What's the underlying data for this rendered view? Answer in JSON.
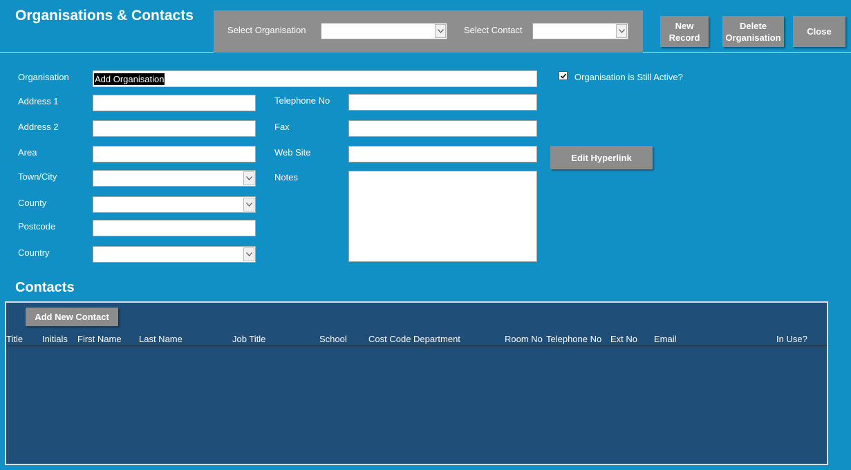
{
  "header": {
    "title": "Organisations & Contacts",
    "select_organisation_label": "Select Organisation",
    "select_organisation_value": "",
    "select_contact_label": "Select Contact",
    "select_contact_value": "",
    "buttons": {
      "new_record_line1": "New",
      "new_record_line2": "Record",
      "delete_org_line1": "Delete",
      "delete_org_line2": "Organisation",
      "close": "Close"
    }
  },
  "form": {
    "organisation_label": "Organisation",
    "organisation_value": "Add Organisation",
    "address1_label": "Address 1",
    "address1_value": "",
    "address2_label": "Address 2",
    "address2_value": "",
    "area_label": "Area",
    "area_value": "",
    "town_label": "Town/City",
    "town_value": "",
    "county_label": "County",
    "county_value": "",
    "postcode_label": "Postcode",
    "postcode_value": "",
    "country_label": "Country",
    "country_value": "",
    "telephone_label": "Telephone No",
    "telephone_value": "",
    "fax_label": "Fax",
    "fax_value": "",
    "website_label": "Web Site",
    "website_value": "",
    "notes_label": "Notes",
    "notes_value": "",
    "active_label": "Organisation is Still Active?",
    "active_checked": true,
    "edit_hyperlink_label": "Edit Hyperlink"
  },
  "contacts": {
    "heading": "Contacts",
    "add_button": "Add New Contact",
    "columns": [
      "Title",
      "Initials",
      "First Name",
      "Last Name",
      "Job Title",
      "School",
      "Cost Code",
      "Department",
      "Room No",
      "Telephone No",
      "Ext No",
      "Email",
      "In Use?"
    ],
    "rows": []
  },
  "colors": {
    "background": "#1190c6",
    "button": "#8c8c8c",
    "subform": "#1f4e79"
  },
  "icons": {
    "dropdown": "chevron-down-icon",
    "check": "checkmark-icon"
  }
}
